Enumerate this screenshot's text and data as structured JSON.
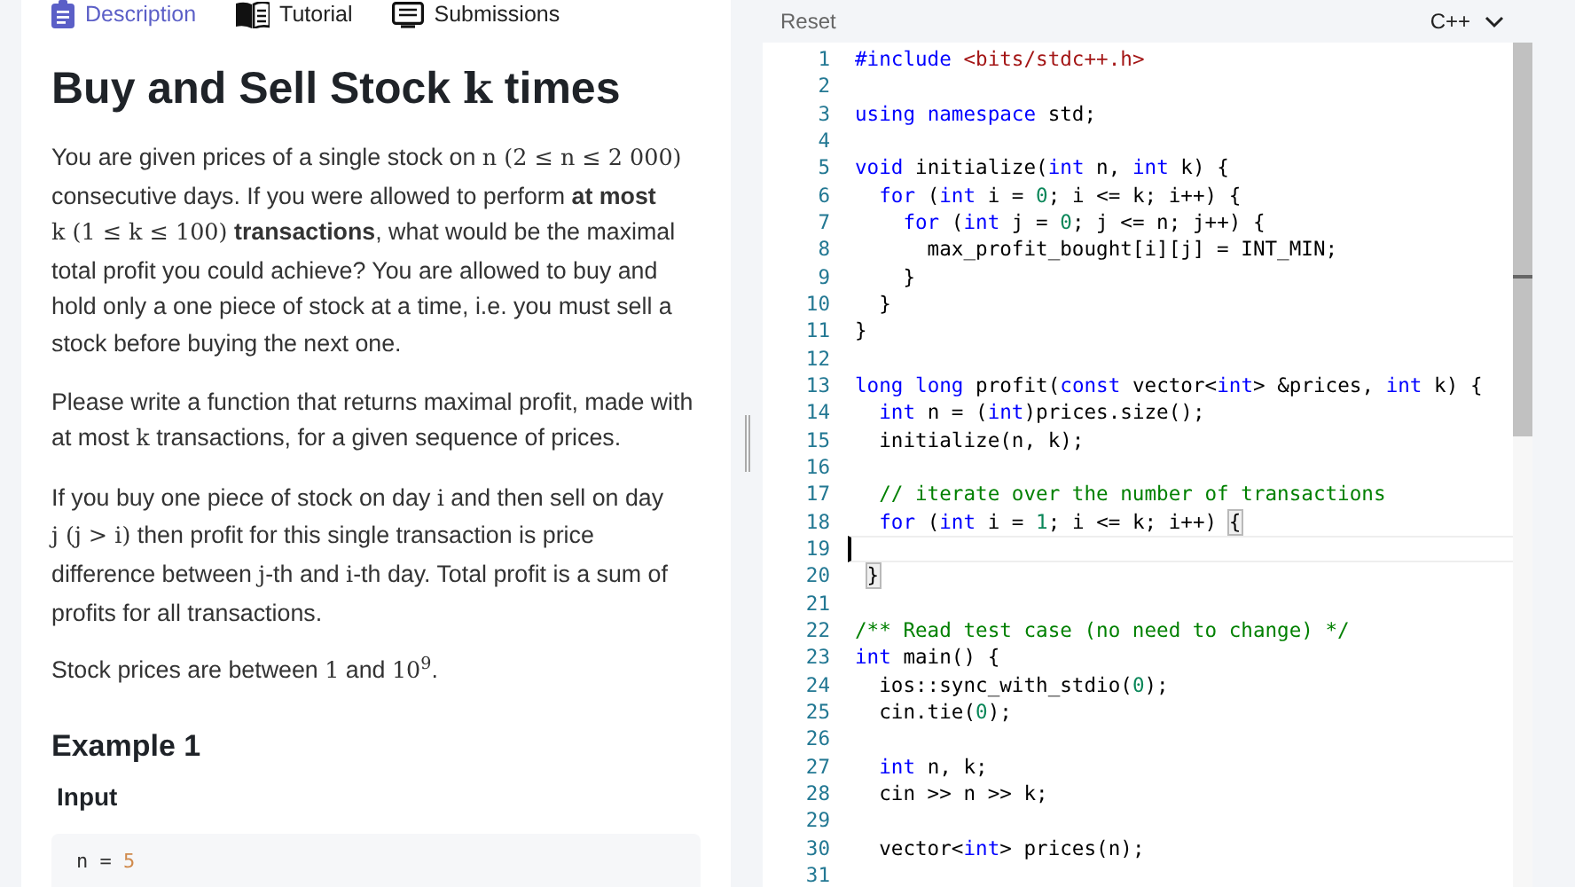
{
  "tabs": [
    {
      "label": "Description",
      "selected": true
    },
    {
      "label": "Tutorial",
      "selected": false
    },
    {
      "label": "Submissions",
      "selected": false
    }
  ],
  "problem": {
    "title": [
      {
        "kind": "text",
        "text": "Buy and Sell Stock "
      },
      {
        "kind": "math",
        "text": "k"
      },
      {
        "kind": "text",
        "text": " times"
      }
    ],
    "paragraphs": [
      [
        {
          "kind": "text",
          "text": "You are given prices of a single stock on "
        },
        {
          "kind": "math",
          "text": "n (2 ≤ n ≤ 2 000)"
        },
        {
          "kind": "text",
          "text": " consecutive days. If you were allowed to perform **at most** "
        },
        {
          "kind": "math",
          "text": "k (1 ≤ k ≤ 100)"
        },
        {
          "kind": "text",
          "text": " **transactions**, what would be the maximal total profit you could achieve? You are allowed to buy and hold only a one piece of stock at a time, i.e. you must sell a stock before buying the next one."
        }
      ],
      [
        {
          "kind": "text",
          "text": "Please write a function that returns maximal profit, made with at most "
        },
        {
          "kind": "math",
          "text": "k"
        },
        {
          "kind": "text",
          "text": " transactions, for a given sequence of prices."
        }
      ],
      [
        {
          "kind": "text",
          "text": "If you buy one piece of stock on day "
        },
        {
          "kind": "math",
          "text": "i"
        },
        {
          "kind": "text",
          "text": " and then sell on day "
        },
        {
          "kind": "math",
          "text": "j (j > i)"
        },
        {
          "kind": "text",
          "text": " then profit for this single transaction is price difference between "
        },
        {
          "kind": "math",
          "text": "j"
        },
        {
          "kind": "text",
          "text": "-th and "
        },
        {
          "kind": "math",
          "text": "i"
        },
        {
          "kind": "text",
          "text": "-th day. Total profit is a sum of profits for all transactions."
        }
      ],
      [
        {
          "kind": "text",
          "text": "Stock prices are between "
        },
        {
          "kind": "math",
          "text": "1"
        },
        {
          "kind": "text",
          "text": " and "
        },
        {
          "kind": "math",
          "text": "10$^{9}$"
        },
        {
          "kind": "text",
          "text": "."
        }
      ]
    ],
    "example": {
      "heading": "Example 1",
      "label": "Input",
      "lines": [
        [
          {
            "kind": "plain",
            "text": "n ="
          },
          {
            "kind": "num",
            "text": " 5"
          }
        ]
      ]
    }
  },
  "editor": {
    "reset": "Reset",
    "language": "C++",
    "lines": [
      {
        "num": "1",
        "tokens": [
          {
            "kind": "kw",
            "text": "#include"
          },
          {
            "kind": "str",
            "text": " <bits/stdc++.h>"
          }
        ]
      },
      {
        "num": "2"
      },
      {
        "num": "3",
        "tokens": [
          {
            "kind": "kw",
            "text": "using"
          },
          {
            "kind": "kw",
            "text": " namespace"
          },
          {
            "kind": "plain",
            "text": " std;"
          }
        ]
      },
      {
        "num": "4"
      },
      {
        "num": "5",
        "tokens": [
          {
            "kind": "kw",
            "text": "void"
          },
          {
            "kind": "plain",
            "text": " initialize("
          },
          {
            "kind": "kw",
            "text": "int"
          },
          {
            "kind": "plain",
            "text": " n, "
          },
          {
            "kind": "kw",
            "text": "int"
          },
          {
            "kind": "plain",
            "text": " k) {"
          }
        ]
      },
      {
        "num": "6",
        "tokens": [
          {
            "kind": "kw",
            "text": "  for"
          },
          {
            "kind": "plain",
            "text": " ("
          },
          {
            "kind": "kw",
            "text": "int"
          },
          {
            "kind": "plain",
            "text": " i = "
          },
          {
            "kind": "num",
            "text": "0"
          },
          {
            "kind": "plain",
            "text": "; i <= k; i++) {"
          }
        ]
      },
      {
        "num": "7",
        "tokens": [
          {
            "kind": "kw",
            "text": "    for"
          },
          {
            "kind": "plain",
            "text": " ("
          },
          {
            "kind": "kw",
            "text": "int"
          },
          {
            "kind": "plain",
            "text": " j = "
          },
          {
            "kind": "num",
            "text": "0"
          },
          {
            "kind": "plain",
            "text": "; j <= n; j++) {"
          }
        ]
      },
      {
        "num": "8",
        "tokens": [
          {
            "kind": "plain",
            "text": "      max_profit_bought[i][j] = INT_MIN;"
          }
        ]
      },
      {
        "num": "9",
        "tokens": [
          {
            "kind": "plain",
            "text": "    }"
          }
        ]
      },
      {
        "num": "10",
        "tokens": [
          {
            "kind": "plain",
            "text": "  }"
          }
        ]
      },
      {
        "num": "11",
        "tokens": [
          {
            "kind": "plain",
            "text": "}"
          }
        ]
      },
      {
        "num": "12"
      },
      {
        "num": "13",
        "tokens": [
          {
            "kind": "kw",
            "text": "long"
          },
          {
            "kind": "kw",
            "text": " long"
          },
          {
            "kind": "plain",
            "text": " profit("
          },
          {
            "kind": "kw",
            "text": "const"
          },
          {
            "kind": "plain",
            "text": " vector<"
          },
          {
            "kind": "kw",
            "text": "int"
          },
          {
            "kind": "plain",
            "text": "> &prices, "
          },
          {
            "kind": "kw",
            "text": "int"
          },
          {
            "kind": "plain",
            "text": " k) {"
          }
        ]
      },
      {
        "num": "14",
        "tokens": [
          {
            "kind": "kw",
            "text": "  int"
          },
          {
            "kind": "plain",
            "text": " n = ("
          },
          {
            "kind": "kw",
            "text": "int"
          },
          {
            "kind": "plain",
            "text": ")prices.size();"
          }
        ]
      },
      {
        "num": "15",
        "tokens": [
          {
            "kind": "plain",
            "text": "  initialize(n, k);"
          }
        ]
      },
      {
        "num": "16"
      },
      {
        "num": "17",
        "tokens": [
          {
            "kind": "comment",
            "text": "  // iterate over the number of transactions"
          }
        ]
      },
      {
        "num": "18",
        "tokens": [
          {
            "kind": "kw",
            "text": "  for"
          },
          {
            "kind": "plain",
            "text": " ("
          },
          {
            "kind": "kw",
            "text": "int"
          },
          {
            "kind": "plain",
            "text": " i = "
          },
          {
            "kind": "num",
            "text": "1"
          },
          {
            "kind": "plain",
            "text": "; i <= k; i++)"
          },
          {
            "kind": "match",
            "text": "{"
          }
        ]
      },
      {
        "num": "19",
        "active": true
      },
      {
        "num": "20",
        "tokens": [
          {
            "kind": "match",
            "text": "}"
          }
        ],
        "indented": true
      },
      {
        "num": "21"
      },
      {
        "num": "22",
        "tokens": [
          {
            "kind": "comment",
            "text": "/** Read test case (no need to change) */"
          }
        ]
      },
      {
        "num": "23",
        "tokens": [
          {
            "kind": "kw",
            "text": "int"
          },
          {
            "kind": "plain",
            "text": " main() {"
          }
        ]
      },
      {
        "num": "24",
        "tokens": [
          {
            "kind": "plain",
            "text": "  ios::sync_with_stdio("
          },
          {
            "kind": "num",
            "text": "0"
          },
          {
            "kind": "plain",
            "text": ");"
          }
        ]
      },
      {
        "num": "25",
        "tokens": [
          {
            "kind": "plain",
            "text": "  cin.tie("
          },
          {
            "kind": "num",
            "text": "0"
          },
          {
            "kind": "plain",
            "text": ");"
          }
        ]
      },
      {
        "num": "26"
      },
      {
        "num": "27",
        "tokens": [
          {
            "kind": "kw",
            "text": "  int"
          },
          {
            "kind": "plain",
            "text": " n, k;"
          }
        ]
      },
      {
        "num": "28",
        "tokens": [
          {
            "kind": "plain",
            "text": "  cin >> n >> k;"
          }
        ]
      },
      {
        "num": "29"
      },
      {
        "num": "30",
        "tokens": [
          {
            "kind": "plain",
            "text": "  vector<"
          },
          {
            "kind": "kw",
            "text": "int"
          },
          {
            "kind": "plain",
            "text": "> prices(n);"
          }
        ]
      },
      {
        "num": "31"
      }
    ]
  }
}
